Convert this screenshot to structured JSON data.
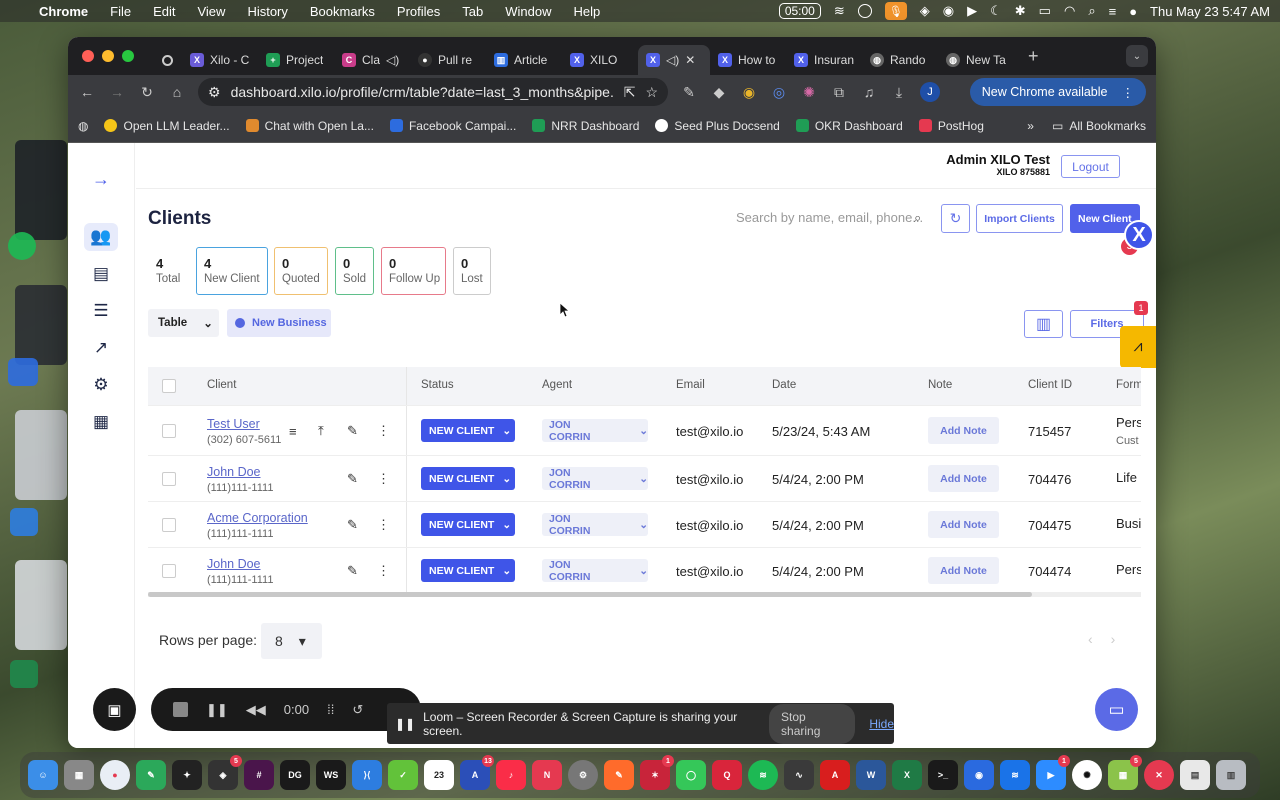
{
  "menubar": {
    "app": "Chrome",
    "items": [
      "File",
      "Edit",
      "View",
      "History",
      "Bookmarks",
      "Profiles",
      "Tab",
      "Window",
      "Help"
    ],
    "recording_time": "05:00",
    "clock": "Thu May 23  5:47 AM"
  },
  "chrome": {
    "tabs": [
      {
        "title": "Xilo - C",
        "color": "#6a5cd8"
      },
      {
        "title": "Project",
        "color": "#1f9d55"
      },
      {
        "title": "Cla",
        "color": "#c93c8a"
      },
      {
        "title": "Pull re",
        "color": "#333333"
      },
      {
        "title": "Article",
        "color": "#2d6cdf"
      },
      {
        "title": "XILO",
        "color": "#5161ea"
      },
      {
        "title": "",
        "color": "#5161ea"
      },
      {
        "title": "How to",
        "color": "#5161ea"
      },
      {
        "title": "Insuran",
        "color": "#5161ea"
      },
      {
        "title": "Rando",
        "color": "#666666"
      },
      {
        "title": "New Ta",
        "color": "#666666"
      }
    ],
    "url": "dashboard.xilo.io/profile/crm/table?date=last_3_months&pipe...",
    "profile_initial": "J",
    "update_banner": "New Chrome available",
    "bookmarks": [
      {
        "label": "Open LLM Leader...",
        "color": "#f5c518"
      },
      {
        "label": "Chat with Open La...",
        "color": "#e08a2e"
      },
      {
        "label": "Facebook Campai...",
        "color": "#2d6cdf"
      },
      {
        "label": "NRR Dashboard",
        "color": "#1f9d55"
      },
      {
        "label": "Seed Plus Docsend",
        "color": "#ffffff"
      },
      {
        "label": "OKR Dashboard",
        "color": "#1f9d55"
      },
      {
        "label": "PostHog",
        "color": "#e53950"
      }
    ],
    "all_bookmarks": "All Bookmarks"
  },
  "header": {
    "admin_name": "Admin XILO Test",
    "admin_code": "XILO 875881",
    "logout": "Logout"
  },
  "clients": {
    "title": "Clients",
    "search_placeholder": "Search by name, email, phone...",
    "import_label": "Import Clients",
    "new_client_label": "New Client",
    "new_client_badge": "3",
    "stats": [
      {
        "value": "4",
        "label": "Total"
      },
      {
        "value": "4",
        "label": "New Client"
      },
      {
        "value": "0",
        "label": "Quoted"
      },
      {
        "value": "0",
        "label": "Sold"
      },
      {
        "value": "0",
        "label": "Follow Up"
      },
      {
        "value": "0",
        "label": "Lost"
      }
    ],
    "view": "Table",
    "pipeline_chip": "New Business",
    "filters_label": "Filters",
    "filters_badge": "1"
  },
  "table": {
    "columns": [
      "Client",
      "Status",
      "Agent",
      "Email",
      "Date",
      "Note",
      "Client ID",
      "Form"
    ],
    "rows": [
      {
        "name": "Test User",
        "phone": "(302) 607-5611",
        "status": "NEW CLIENT",
        "agent": "JON CORRIN",
        "email": "test@xilo.io",
        "date": "5/23/24, 5:43 AM",
        "note": "Add Note",
        "id": "715457",
        "form": "Pers",
        "form2": "Cust"
      },
      {
        "name": "John Doe",
        "phone": "(111)111-1111",
        "status": "NEW CLIENT",
        "agent": "JON CORRIN",
        "email": "test@xilo.io",
        "date": "5/4/24, 2:00 PM",
        "note": "Add Note",
        "id": "704476",
        "form": "Life",
        "form2": ""
      },
      {
        "name": "Acme Corporation",
        "phone": "(111)111-1111",
        "status": "NEW CLIENT",
        "agent": "JON CORRIN",
        "email": "test@xilo.io",
        "date": "5/4/24, 2:00 PM",
        "note": "Add Note",
        "id": "704475",
        "form": "Busi",
        "form2": ""
      },
      {
        "name": "John Doe",
        "phone": "(111)111-1111",
        "status": "NEW CLIENT",
        "agent": "JON CORRIN",
        "email": "test@xilo.io",
        "date": "5/4/24, 2:00 PM",
        "note": "Add Note",
        "id": "704474",
        "form": "Pers",
        "form2": ""
      }
    ]
  },
  "pagination": {
    "rows_per_page_label": "Rows per page:",
    "rows_per_page": "8"
  },
  "loom": {
    "timer": "0:00",
    "share_message": "Loom – Screen Recorder & Screen Capture is sharing your screen.",
    "stop_sharing": "Stop sharing",
    "hide": "Hide"
  },
  "dock": {
    "calendar_day": "23",
    "badges": {
      "slack": "5",
      "xcode": "13",
      "calendar": "",
      "discord": "1",
      "zoom": "1",
      "app": "5"
    }
  }
}
